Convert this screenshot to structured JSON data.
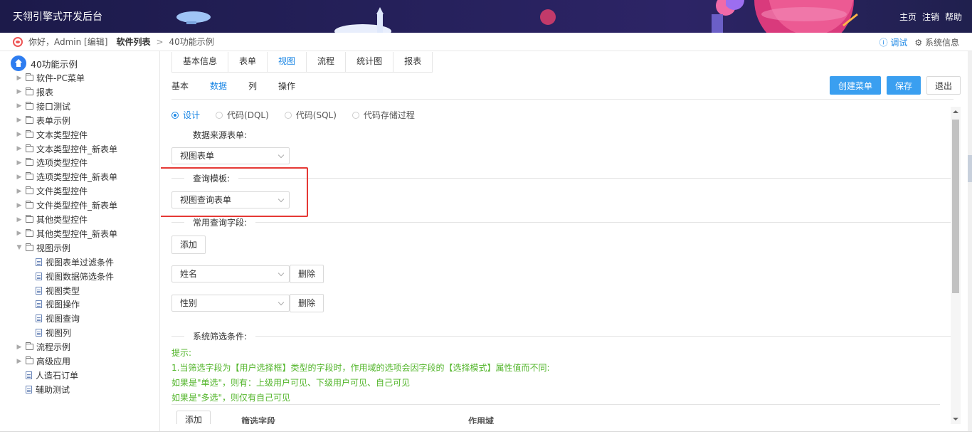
{
  "app": {
    "title": "天翎引擎式开发后台"
  },
  "top_nav": {
    "home": "主页",
    "logout": "注销",
    "help": "帮助"
  },
  "breadcrumb": {
    "greeting": "你好，Admin [编辑]",
    "software_list": "软件列表",
    "separator": ">",
    "current": "40功能示例"
  },
  "crumb_right": {
    "debug": "ⓘ 调试",
    "system_info": "⚙ 系统信息"
  },
  "sidebar": {
    "root": "40功能示例",
    "items": [
      {
        "label": "软件-PC菜单",
        "type": "folder"
      },
      {
        "label": "报表",
        "type": "folder"
      },
      {
        "label": "接口测试",
        "type": "folder"
      },
      {
        "label": "表单示例",
        "type": "folder"
      },
      {
        "label": "文本类型控件",
        "type": "folder"
      },
      {
        "label": "文本类型控件_新表单",
        "type": "folder"
      },
      {
        "label": "选项类型控件",
        "type": "folder"
      },
      {
        "label": "选项类型控件_新表单",
        "type": "folder"
      },
      {
        "label": "文件类型控件",
        "type": "folder"
      },
      {
        "label": "文件类型控件_新表单",
        "type": "folder"
      },
      {
        "label": "其他类型控件",
        "type": "folder"
      },
      {
        "label": "其他类型控件_新表单",
        "type": "folder"
      },
      {
        "label": "视图示例",
        "type": "folder-open"
      },
      {
        "label": "视图表单过滤条件",
        "type": "file"
      },
      {
        "label": "视图数据筛选条件",
        "type": "file"
      },
      {
        "label": "视图类型",
        "type": "file"
      },
      {
        "label": "视图操作",
        "type": "file"
      },
      {
        "label": "视图查询",
        "type": "file"
      },
      {
        "label": "视图列",
        "type": "file"
      },
      {
        "label": "流程示例",
        "type": "folder"
      },
      {
        "label": "高级应用",
        "type": "folder"
      },
      {
        "label": "人造石订单",
        "type": "file"
      },
      {
        "label": "辅助测试",
        "type": "file"
      }
    ]
  },
  "tabs": [
    "基本信息",
    "表单",
    "视图",
    "流程",
    "统计图",
    "报表"
  ],
  "active_tab": "视图",
  "sub_tabs": [
    "基本",
    "数据",
    "列",
    "操作"
  ],
  "active_sub_tab": "数据",
  "actions": {
    "create_menu": "创建菜单",
    "save": "保存",
    "exit": "退出"
  },
  "radios": [
    "设计",
    "代码(DQL)",
    "代码(SQL)",
    "代码存储过程"
  ],
  "radio_selected": "设计",
  "form": {
    "data_source_label": "数据来源表单:",
    "data_source_value": "视图表单",
    "query_template_label": "查询模板:",
    "query_template_value": "视图查询表单",
    "common_fields_label": "常用查询字段:",
    "add": "添加",
    "field1": "姓名",
    "field2": "性别",
    "delete": "删除",
    "system_filter_label": "系统筛选条件:"
  },
  "hint": {
    "line1": "提示:",
    "line2": "1.当筛选字段为【用户选择框】类型的字段时，作用域的选项会因字段的【选择模式】属性值而不同:",
    "line3": "如果是\"单选\"，则有：上级用户可见、下级用户可见、自己可见",
    "line4": "如果是\"多选\"，则仅有自己可见"
  },
  "table": {
    "add": "添加",
    "col_filter_field": "筛选字段",
    "col_scope": "作用域"
  },
  "colors": {
    "accent": "#1e88e5",
    "primary_button": "#3a9ff0",
    "hint_green": "#52b52a",
    "highlight_red": "#e53935",
    "topbar": "#26215c"
  }
}
